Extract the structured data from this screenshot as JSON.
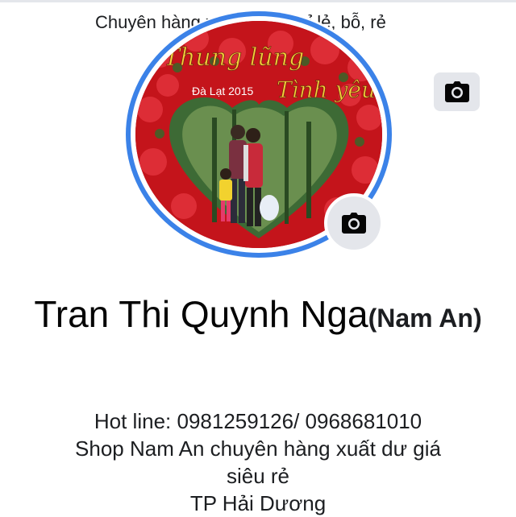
{
  "cover": {
    "caption": "Chuyên hàng xuất dư giá sỉ lẻ, bỗ, rẻ",
    "camera_icon": "camera-icon"
  },
  "avatar": {
    "sign_line1": "Thung lũng",
    "sign_line2": "Đà Lạt 2015",
    "sign_line3": "Tình yêu",
    "camera_icon": "camera-icon"
  },
  "profile": {
    "name": "Tran Thi Quynh Nga",
    "alt_name": "(Nam An)"
  },
  "bio": {
    "line1": "Hot line: 0981259126/ 0968681010",
    "line2": "Shop Nam An chuyên hàng xuất dư giá",
    "line3": "siêu rẻ",
    "line4": "TP Hải Dương"
  },
  "colors": {
    "story_ring": "#3b82e8",
    "button_bg": "#e4e6eb"
  }
}
